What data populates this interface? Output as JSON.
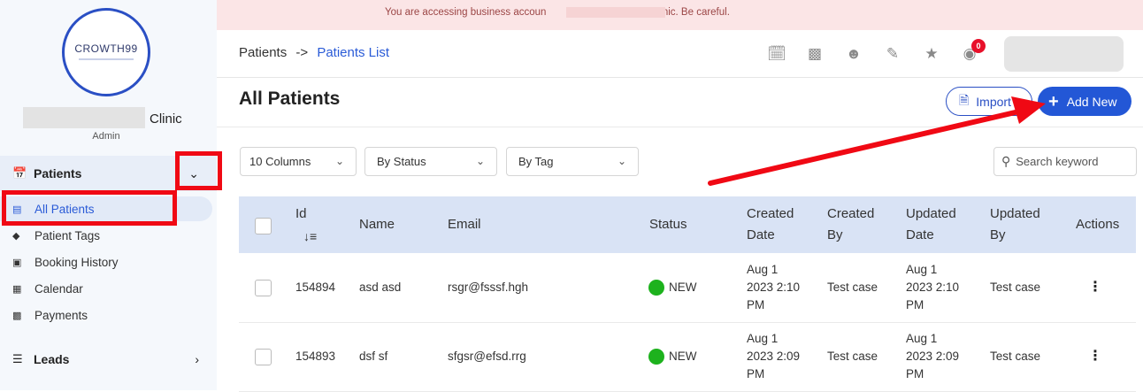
{
  "banner": {
    "prefix": "You are accessing business accoun",
    "suffix": "Clinic. Be careful."
  },
  "sidebar": {
    "logo_text": "CROWTH99",
    "clinic_name": "Clinic",
    "role": "Admin",
    "patients_group": {
      "label": "Patients",
      "icon": "calendar-check-icon",
      "expanded": true
    },
    "items": [
      {
        "label": "All Patients",
        "icon": "bed-icon",
        "active": true
      },
      {
        "label": "Patient Tags",
        "icon": "tags-icon"
      },
      {
        "label": "Booking History",
        "icon": "id-card-icon"
      },
      {
        "label": "Calendar",
        "icon": "calendar-icon"
      },
      {
        "label": "Payments",
        "icon": "money-icon"
      }
    ],
    "leads_group": {
      "label": "Leads",
      "icon": "list-icon"
    }
  },
  "header": {
    "breadcrumb": {
      "root": "Patients",
      "separator": "->",
      "current": "Patients List"
    },
    "icons": [
      "calendar-check-icon",
      "robot-icon",
      "user-doctor-icon",
      "edit-icon",
      "star-icon",
      "chat-icon"
    ],
    "notification_count": "0"
  },
  "page": {
    "title": "All Patients",
    "import_label": "Import",
    "add_label": "Add New"
  },
  "filters": {
    "columns": "10 Columns",
    "status": "By Status",
    "tag": "By Tag",
    "search_placeholder": "Search keyword"
  },
  "table": {
    "headers": {
      "id": "Id",
      "name": "Name",
      "email": "Email",
      "status": "Status",
      "created_date_1": "Created",
      "created_date_2": "Date",
      "created_by_1": "Created",
      "created_by_2": "By",
      "updated_date_1": "Updated",
      "updated_date_2": "Date",
      "updated_by_1": "Updated",
      "updated_by_2": "By",
      "actions": "Actions"
    },
    "rows": [
      {
        "id": "154894",
        "name": "asd asd",
        "email": "rsgr@fsssf.hgh",
        "status": "NEW",
        "created_1": "Aug 1",
        "created_2": "2023 2:10",
        "created_3": "PM",
        "created_by": "Test case",
        "updated_1": "Aug 1",
        "updated_2": "2023 2:10",
        "updated_3": "PM",
        "updated_by": "Test case"
      },
      {
        "id": "154893",
        "name": "dsf sf",
        "email": "sfgsr@efsd.rrg",
        "status": "NEW",
        "created_1": "Aug 1",
        "created_2": "2023 2:09",
        "created_3": "PM",
        "created_by": "Test case",
        "updated_1": "Aug 1",
        "updated_2": "2023 2:09",
        "updated_3": "PM",
        "updated_by": "Test case"
      }
    ]
  },
  "colors": {
    "accent": "#2357d6",
    "status_new": "#1db21d",
    "annotation": "#f00914"
  }
}
